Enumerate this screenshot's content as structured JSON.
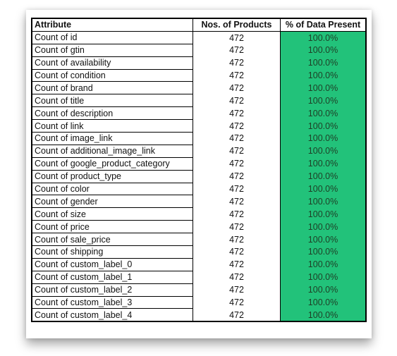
{
  "headers": {
    "attribute": "Attribute",
    "products": "Nos. of Products",
    "percent": "% of Data Present"
  },
  "colors": {
    "present_fill": "#22c27a"
  },
  "rows": [
    {
      "attribute": "Count of id",
      "products": "472",
      "percent": "100.0%"
    },
    {
      "attribute": "Count of gtin",
      "products": "472",
      "percent": "100.0%"
    },
    {
      "attribute": "Count of availability",
      "products": "472",
      "percent": "100.0%"
    },
    {
      "attribute": "Count of condition",
      "products": "472",
      "percent": "100.0%"
    },
    {
      "attribute": "Count of brand",
      "products": "472",
      "percent": "100.0%"
    },
    {
      "attribute": "Count of title",
      "products": "472",
      "percent": "100.0%"
    },
    {
      "attribute": "Count of description",
      "products": "472",
      "percent": "100.0%"
    },
    {
      "attribute": "Count of link",
      "products": "472",
      "percent": "100.0%"
    },
    {
      "attribute": "Count of image_link",
      "products": "472",
      "percent": "100.0%"
    },
    {
      "attribute": "Count of additional_image_link",
      "products": "472",
      "percent": "100.0%"
    },
    {
      "attribute": "Count of google_product_category",
      "products": "472",
      "percent": "100.0%"
    },
    {
      "attribute": "Count of product_type",
      "products": "472",
      "percent": "100.0%"
    },
    {
      "attribute": "Count of color",
      "products": "472",
      "percent": "100.0%"
    },
    {
      "attribute": "Count of gender",
      "products": "472",
      "percent": "100.0%"
    },
    {
      "attribute": "Count of size",
      "products": "472",
      "percent": "100.0%"
    },
    {
      "attribute": "Count of price",
      "products": "472",
      "percent": "100.0%"
    },
    {
      "attribute": "Count of sale_price",
      "products": "472",
      "percent": "100.0%"
    },
    {
      "attribute": "Count of shipping",
      "products": "472",
      "percent": "100.0%"
    },
    {
      "attribute": "Count of custom_label_0",
      "products": "472",
      "percent": "100.0%"
    },
    {
      "attribute": "Count of custom_label_1",
      "products": "472",
      "percent": "100.0%"
    },
    {
      "attribute": "Count of custom_label_2",
      "products": "472",
      "percent": "100.0%"
    },
    {
      "attribute": "Count of custom_label_3",
      "products": "472",
      "percent": "100.0%"
    },
    {
      "attribute": "Count of custom_label_4",
      "products": "472",
      "percent": "100.0%"
    }
  ]
}
